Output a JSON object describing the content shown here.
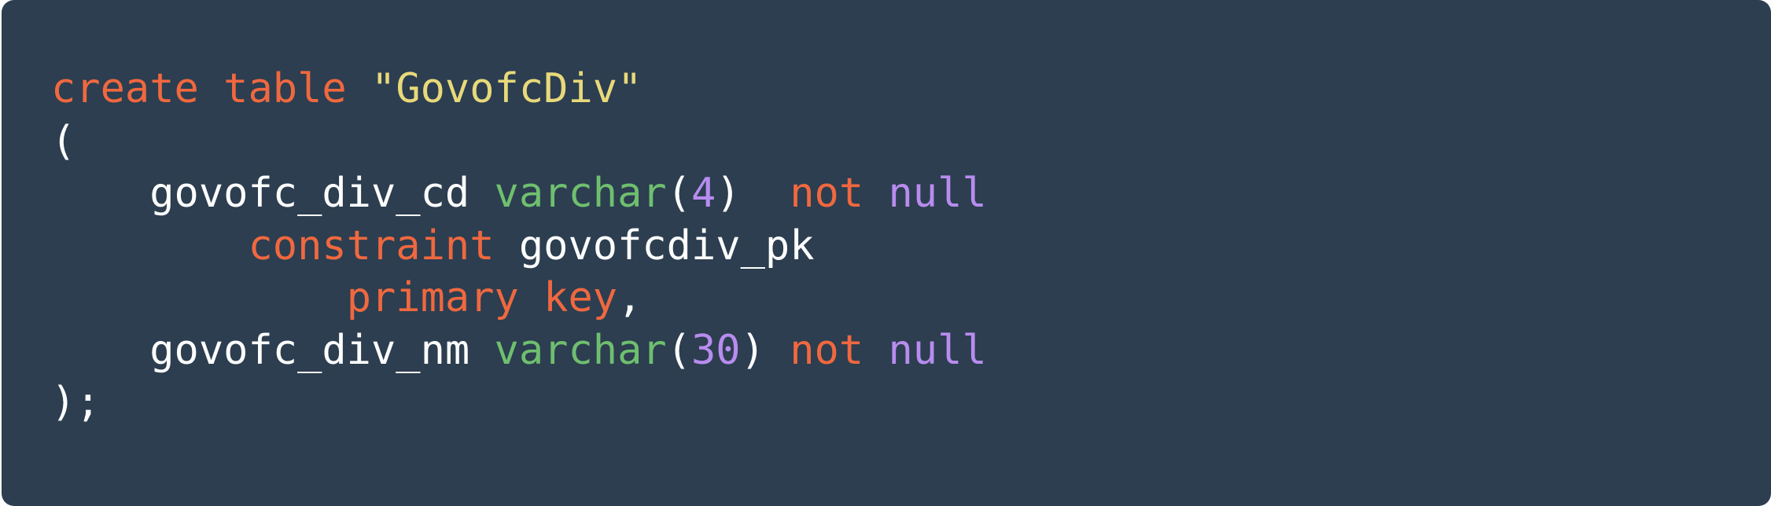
{
  "code": {
    "lines": [
      [
        {
          "text": "create",
          "cls": "kw"
        },
        {
          "text": " ",
          "cls": "plain"
        },
        {
          "text": "table",
          "cls": "kw"
        },
        {
          "text": " ",
          "cls": "plain"
        },
        {
          "text": "\"GovofcDiv\"",
          "cls": "str"
        }
      ],
      [
        {
          "text": "(",
          "cls": "plain"
        }
      ],
      [
        {
          "text": "    govofc_div_cd ",
          "cls": "plain"
        },
        {
          "text": "varchar",
          "cls": "type"
        },
        {
          "text": "(",
          "cls": "plain"
        },
        {
          "text": "4",
          "cls": "num"
        },
        {
          "text": ")  ",
          "cls": "plain"
        },
        {
          "text": "not",
          "cls": "kw"
        },
        {
          "text": " ",
          "cls": "plain"
        },
        {
          "text": "null",
          "cls": "nul"
        }
      ],
      [
        {
          "text": "        ",
          "cls": "plain"
        },
        {
          "text": "constraint",
          "cls": "kw"
        },
        {
          "text": " govofcdiv_pk",
          "cls": "plain"
        }
      ],
      [
        {
          "text": "            ",
          "cls": "plain"
        },
        {
          "text": "primary",
          "cls": "kw"
        },
        {
          "text": " ",
          "cls": "plain"
        },
        {
          "text": "key",
          "cls": "kw"
        },
        {
          "text": ",",
          "cls": "plain"
        }
      ],
      [
        {
          "text": "    govofc_div_nm ",
          "cls": "plain"
        },
        {
          "text": "varchar",
          "cls": "type"
        },
        {
          "text": "(",
          "cls": "plain"
        },
        {
          "text": "30",
          "cls": "num"
        },
        {
          "text": ") ",
          "cls": "plain"
        },
        {
          "text": "not",
          "cls": "kw"
        },
        {
          "text": " ",
          "cls": "plain"
        },
        {
          "text": "null",
          "cls": "nul"
        }
      ],
      [
        {
          "text": ");",
          "cls": "plain"
        }
      ]
    ]
  },
  "colors": {
    "background": "#2c3e50",
    "keyword": "#f0683f",
    "string": "#e8d97a",
    "type": "#6fbf6f",
    "number": "#b88cef",
    "text": "#ffffff"
  }
}
